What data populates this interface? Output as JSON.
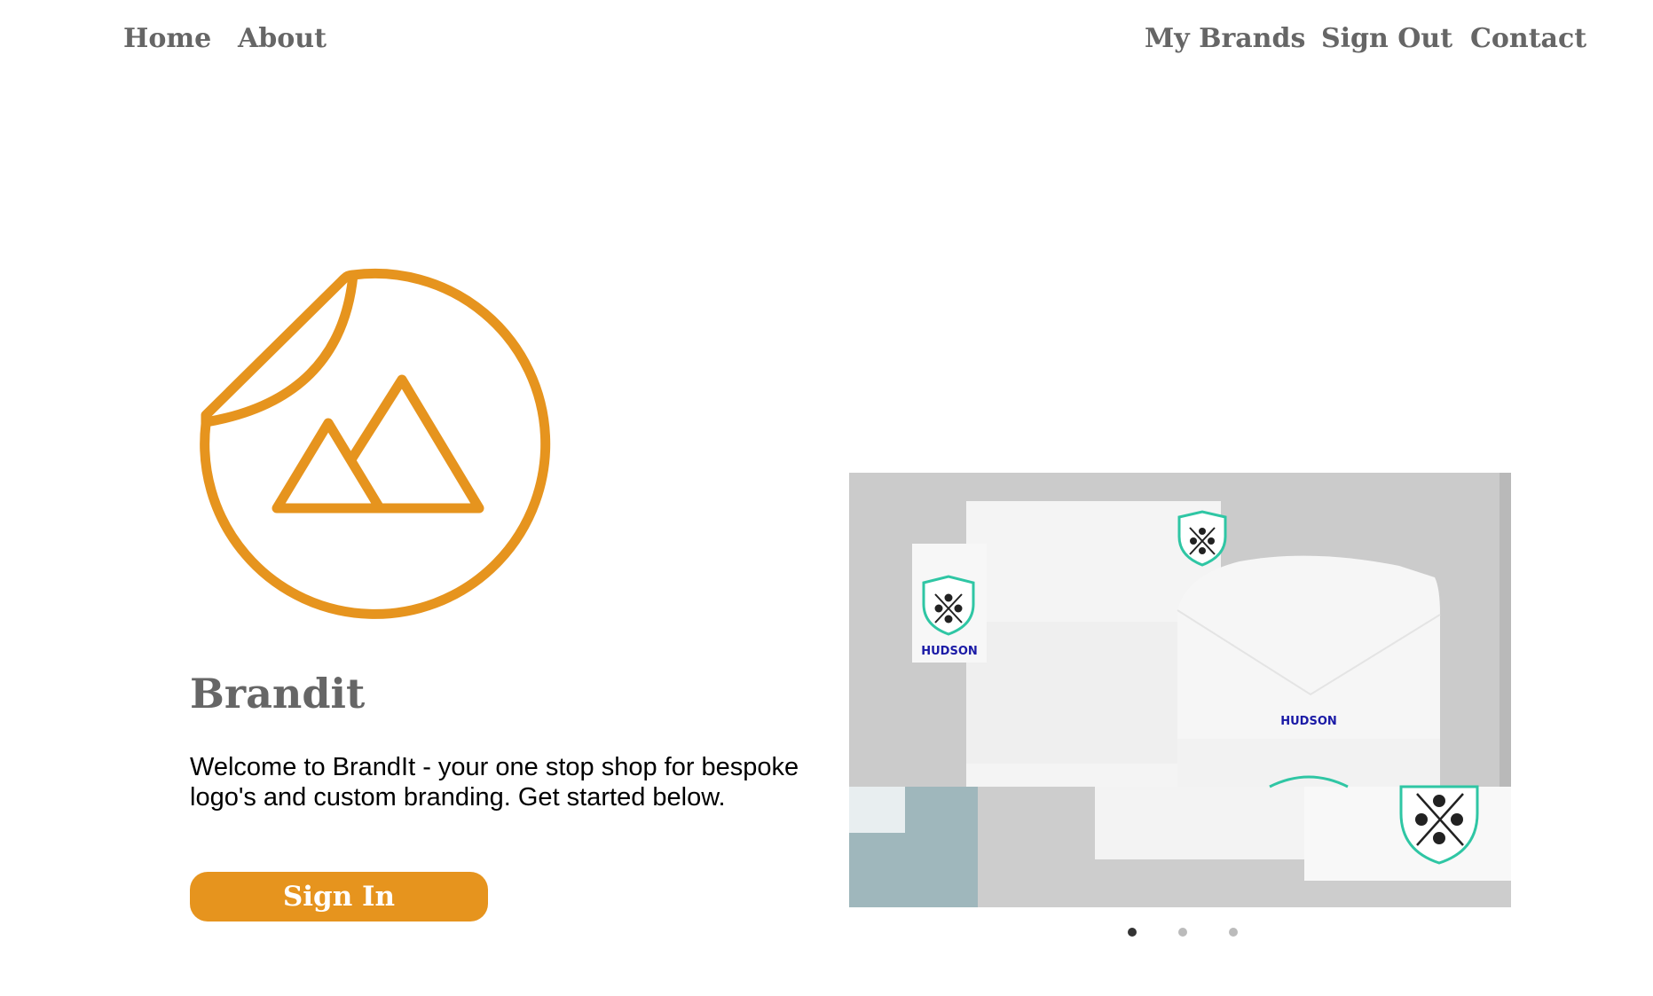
{
  "nav": {
    "left": [
      {
        "label": "Home"
      },
      {
        "label": "About"
      }
    ],
    "right": [
      {
        "label": "My Brands"
      },
      {
        "label": "Sign Out"
      },
      {
        "label": "Contact"
      }
    ]
  },
  "hero": {
    "logo_icon": "sticker-mountains-icon",
    "title": "Brandit",
    "description": "Welcome to BrandIt - your one stop shop for bespoke logo's and custom branding. Get started below.",
    "cta_label": "Sign In"
  },
  "carousel": {
    "slide_brand_text_1": "HUDSON",
    "slide_brand_text_2": "HUDSON",
    "slide_count": 3,
    "active_index": 0
  },
  "colors": {
    "accent": "#e6941e",
    "nav_text": "#666666",
    "shield_teal": "#2fc6a4",
    "shield_text": "#1a1aa6"
  }
}
